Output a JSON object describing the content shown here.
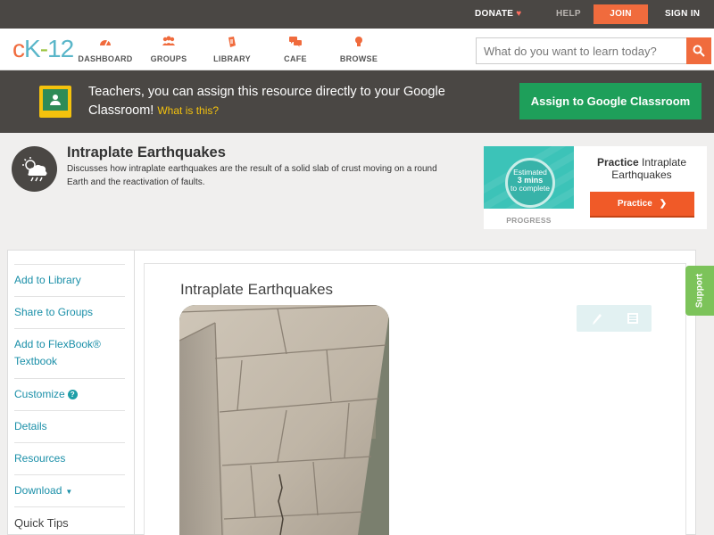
{
  "topbar": {
    "donate": "DONATE",
    "help": "HELP",
    "join": "JOIN",
    "signin": "SIGN IN"
  },
  "logo": {
    "part1": "c",
    "part2": "K",
    "part3": "-",
    "part4": "12"
  },
  "nav": {
    "items": [
      {
        "label": "DASHBOARD"
      },
      {
        "label": "GROUPS"
      },
      {
        "label": "LIBRARY"
      },
      {
        "label": "CAFE"
      },
      {
        "label": "BROWSE"
      }
    ]
  },
  "search": {
    "placeholder": "What do you want to learn today?"
  },
  "banner": {
    "text": "Teachers, you can assign this resource directly to your Google Classroom!",
    "what_link": "What is this?",
    "button": "Assign to Google Classroom"
  },
  "concept": {
    "title": "Intraplate Earthquakes",
    "description": "Discusses how intraplate earthquakes are the result of a solid slab of crust moving on a round Earth and the reactivation of faults."
  },
  "practice_card": {
    "estimate_line1": "Estimated",
    "estimate_mins": "3 mins",
    "estimate_line3": "to complete",
    "progress_label": "PROGRESS",
    "title_bold": "Practice",
    "title_rest": "Intraplate Earthquakes",
    "button": "Practice"
  },
  "sidebar": {
    "items": [
      {
        "label": "Add to Library"
      },
      {
        "label": "Share to Groups"
      },
      {
        "label": "Add to FlexBook® Textbook"
      },
      {
        "label": "Customize"
      },
      {
        "label": "Details"
      },
      {
        "label": "Resources"
      },
      {
        "label": "Download"
      }
    ],
    "help_badge": "?",
    "quick_tips": "Quick Tips"
  },
  "content": {
    "title": "Intraplate Earthquakes"
  },
  "support_tab": "Support",
  "colors": {
    "accent_orange": "#f06b3d",
    "google_green": "#1e9f5a",
    "link_teal": "#1a8fa8",
    "dark_bar": "#4a4744"
  }
}
